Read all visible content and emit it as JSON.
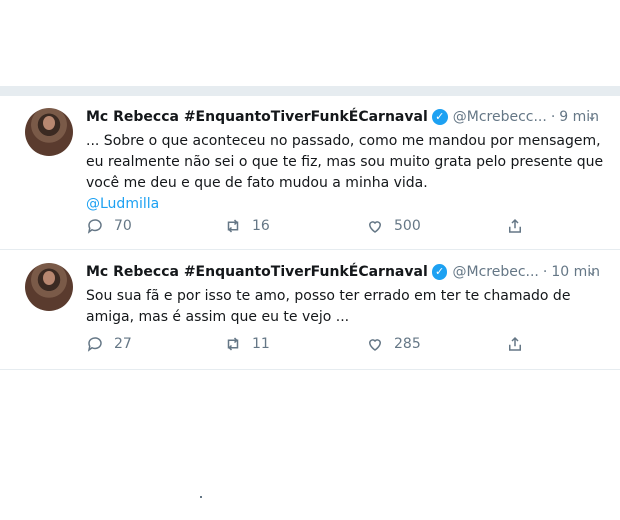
{
  "tweets": [
    {
      "name": "Mc Rebecca #EnquantoTiverFunkÉCarnaval",
      "handle": "@Mcrebecc...",
      "separator": "·",
      "time": "9 min",
      "text": "... Sobre o que aconteceu no passado, como me mandou por mensagem, eu realmente não sei o que te fiz, mas sou muito grata pelo presente que você me deu e que de fato mudou a minha vida.",
      "mention": "@Ludmilla",
      "replies": "70",
      "retweets": "16",
      "likes": "500"
    },
    {
      "name": "Mc Rebecca #EnquantoTiverFunkÉCarnaval",
      "handle": "@Mcrebec...",
      "separator": "·",
      "time": "10 min",
      "text": "Sou sua fã e por isso te amo, posso ter errado em ter te chamado de amiga, mas é assim que eu te vejo ...",
      "replies": "27",
      "retweets": "11",
      "likes": "285"
    }
  ],
  "icons": {
    "verified": "verified-badge-icon",
    "menu": "chevron-down-icon",
    "reply": "reply-icon",
    "retweet": "retweet-icon",
    "like": "heart-icon",
    "share": "share-icon"
  },
  "colors": {
    "accent": "#1da1f2",
    "muted": "#657786",
    "divider": "#e6ecf0"
  }
}
